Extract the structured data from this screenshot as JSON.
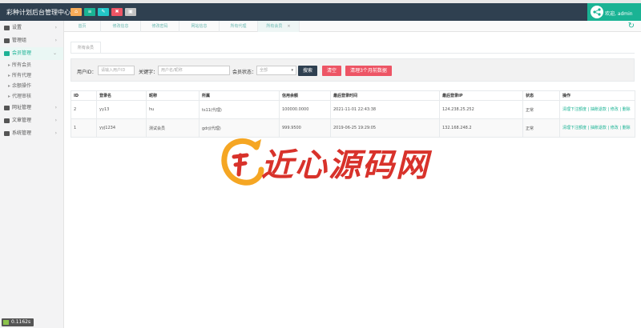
{
  "header": {
    "app_title": "彩种计划后台管理中心",
    "user": "欢迎, admin"
  },
  "sidebar": {
    "items": [
      {
        "label": "设置",
        "icon": "gear-icon"
      },
      {
        "label": "管理组",
        "icon": "users-icon"
      },
      {
        "label": "会员管理",
        "icon": "member-icon",
        "active": true
      },
      {
        "label": "网址管理",
        "icon": "grid-icon"
      },
      {
        "label": "文章管理",
        "icon": "doc-icon"
      },
      {
        "label": "系统管理",
        "icon": "system-icon"
      }
    ],
    "subitems": [
      "所有会员",
      "所有代理",
      "余额操作",
      "代理审核"
    ],
    "timer": "0.1162s"
  },
  "tabs": [
    "首页",
    "修改信息",
    "修改密码",
    "网站信息",
    "所有代理",
    "所有会员"
  ],
  "inner_tab": "所有会员",
  "search": {
    "user_id_label": "用户ID：",
    "user_id_placeholder": "请输入用户ID",
    "keyword_label": "关键字：",
    "keyword_placeholder": "用户名/昵称",
    "status_label": "会员状态：",
    "status_value": "全部",
    "search_button": "搜索",
    "clear_button": "清空",
    "purge_button": "清理3个月前数据"
  },
  "table": {
    "columns": [
      "ID",
      "登录名",
      "昵称",
      "所属",
      "信用余额",
      "最后登录时间",
      "最后登录IP",
      "状态",
      "操作"
    ],
    "rows": [
      {
        "id": "2",
        "login": "yy13",
        "nick": "hu",
        "owner": "ts11(代理)",
        "balance": "100000.0000",
        "last_time": "2021-11-01 22:43:38",
        "last_ip": "124.238.25.252",
        "status": "正常",
        "ops": "清理下注额度 | 抽账退款 | 修改 | 删除"
      },
      {
        "id": "1",
        "login": "yyj1234",
        "nick": "测试会员",
        "owner": "gdrj(代理)",
        "balance": "999.9500",
        "last_time": "2019-06-25 19:29:05",
        "last_ip": "132.168.248.2",
        "status": "正常",
        "ops": "清理下注额度 | 抽账退款 | 修改 | 删除"
      }
    ]
  },
  "watermark": "近心源码网",
  "colors": {
    "accent": "#1ab394",
    "topbar": "#2f4050",
    "danger": "#ed5565",
    "watermark": "#d8322b"
  }
}
